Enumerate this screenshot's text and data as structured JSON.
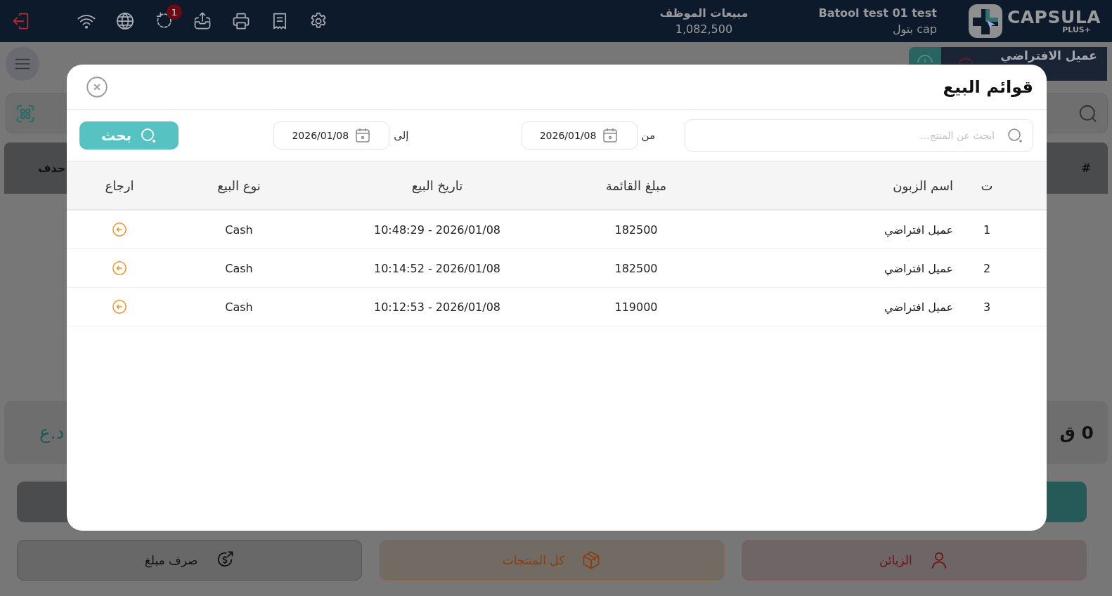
{
  "top_bar": {
    "logo": {
      "name": "CAPSULA",
      "tagline": "PLUS+"
    },
    "user": {
      "name": "Batool test 01 test",
      "subtitle": "بتول cap"
    },
    "employee_sales": {
      "label": "مبيعات الموظف",
      "value": "1,082,500"
    },
    "sync_badge": "1"
  },
  "background": {
    "customer": "عميل الافتراضي",
    "delete_header": "حذف",
    "index_header": "#",
    "total": "0 ق",
    "currency": "د.ع",
    "actions": [
      {
        "label": "الزبائن",
        "kind": "customers"
      },
      {
        "label": "كل المنتجات",
        "kind": "products"
      },
      {
        "label": "صرف مبلغ",
        "kind": "expense"
      }
    ]
  },
  "dialog": {
    "title": "قوائم البيع",
    "search": {
      "placeholder": "ابحث عن المنتج..."
    },
    "from": {
      "label": "من",
      "value": "2026/01/08"
    },
    "to": {
      "label": "إلى",
      "value": "2026/01/08"
    },
    "search_button": "بحث",
    "table": {
      "columns": [
        "ت",
        "اسم الزبون",
        "مبلغ القائمة",
        "تاريخ البيع",
        "نوع البيع",
        "ارجاع"
      ],
      "rows": [
        {
          "index": "1",
          "customer": "عميل افتراضي",
          "amount": "182500",
          "date": "10:48:29 - 2026/01/08",
          "sale_type": "Cash"
        },
        {
          "index": "2",
          "customer": "عميل افتراضي",
          "amount": "182500",
          "date": "10:14:52 - 2026/01/08",
          "sale_type": "Cash"
        },
        {
          "index": "3",
          "customer": "عميل افتراضي",
          "amount": "119000",
          "date": "10:12:53 - 2026/01/08",
          "sale_type": "Cash"
        }
      ]
    }
  }
}
